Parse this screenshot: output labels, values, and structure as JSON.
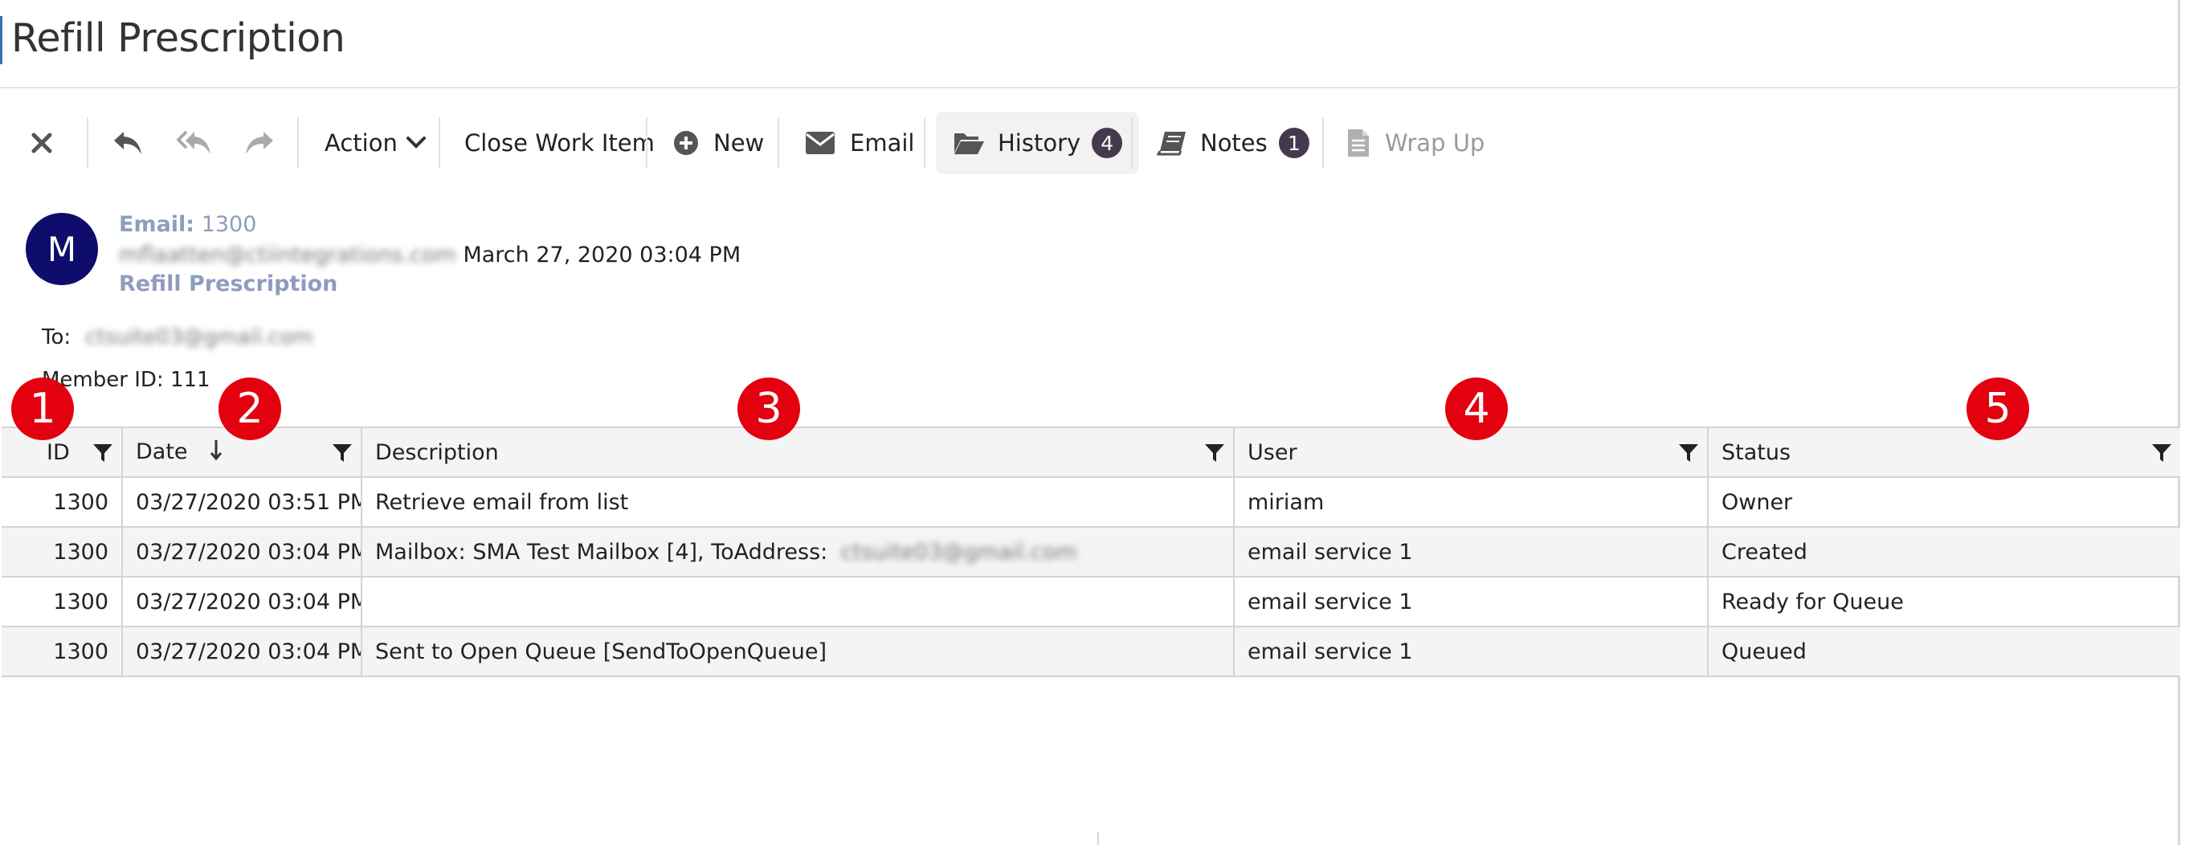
{
  "window": {
    "title": "Refill Prescription"
  },
  "toolbar": {
    "close_icon": "close-icon",
    "reply_icon": "reply-icon",
    "reply_all_icon": "reply-all-icon",
    "forward_icon": "forward-icon",
    "action_label": "Action",
    "close_work_item_label": "Close Work Item",
    "new_label": "New",
    "email_label": "Email",
    "history_label": "History",
    "history_count": "4",
    "notes_label": "Notes",
    "notes_count": "1",
    "wrap_up_label": "Wrap Up"
  },
  "email": {
    "avatar_initial": "M",
    "id_label": "Email:",
    "id_value": "1300",
    "from_address": "mflaatten@ctiintegrations.com",
    "datetime": "March 27, 2020 03:04 PM",
    "subject": "Refill Prescription",
    "to_label": "To:",
    "to_address": "ctsuite03@gmail.com",
    "member_label": "Member ID:",
    "member_value": "111"
  },
  "markers": [
    "1",
    "2",
    "3",
    "4",
    "5"
  ],
  "history_table": {
    "columns": [
      "ID",
      "Date",
      "Description",
      "User",
      "Status"
    ],
    "sort": {
      "column": "Date",
      "direction": "descending"
    },
    "rows": [
      {
        "id": "1300",
        "date": "03/27/2020 03:51 PM",
        "description": "Retrieve email from list",
        "description_blurred": "",
        "user": "miriam",
        "status": "Owner"
      },
      {
        "id": "1300",
        "date": "03/27/2020 03:04 PM",
        "description": "Mailbox: SMA Test Mailbox [4], ToAddress:",
        "description_blurred": "ctsuite03@gmail.com",
        "user": "email service 1",
        "status": "Created"
      },
      {
        "id": "1300",
        "date": "03/27/2020 03:04 PM",
        "description": "",
        "description_blurred": "",
        "user": "email service 1",
        "status": "Ready for Queue"
      },
      {
        "id": "1300",
        "date": "03/27/2020 03:04 PM",
        "description": "Sent to Open Queue [SendToOpenQueue]",
        "description_blurred": "",
        "user": "email service 1",
        "status": "Queued"
      }
    ]
  },
  "colors": {
    "avatar": "#0f0d6b",
    "marker": "#e3000f",
    "badge": "#443a4e",
    "muted_link": "#8f9cbf"
  }
}
